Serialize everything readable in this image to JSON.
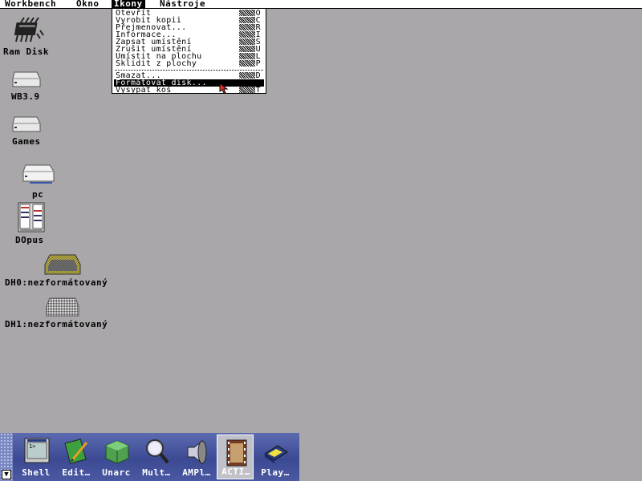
{
  "menubar": {
    "items": [
      "Workbench",
      "Okno",
      "Ikony",
      "Nástroje"
    ],
    "active": "Ikony"
  },
  "menu": {
    "items": [
      {
        "label": "Otevřít",
        "key": "O"
      },
      {
        "label": "Vyrobit kopii",
        "key": "C"
      },
      {
        "label": "Přejmenovat...",
        "key": "R"
      },
      {
        "label": "Informace...",
        "key": "I"
      },
      {
        "label": "Zapsat umístění",
        "key": "S"
      },
      {
        "label": "Zrušit umístění",
        "key": "U"
      },
      {
        "label": "Umístit na plochu",
        "key": "L"
      },
      {
        "label": "Sklidit z plochy",
        "key": "P"
      },
      {
        "label": "Smazat...",
        "key": "D"
      },
      {
        "label": "Formátovat disk...",
        "key": ""
      },
      {
        "label": "Vysypat koš",
        "key": "T"
      }
    ],
    "selected": "Formátovat disk..."
  },
  "desktop": {
    "icons": [
      {
        "label": "Ram Disk",
        "icon": "ram-disk-chip-icon"
      },
      {
        "label": "WB3.9",
        "icon": "drive-icon"
      },
      {
        "label": "Games",
        "icon": "drive-icon"
      },
      {
        "label": "pc",
        "icon": "drive-icon"
      },
      {
        "label": "DOpus",
        "icon": "dopus-app-icon"
      },
      {
        "label": "DH0:nezformátovaný",
        "icon": "unformatted-disk-icon"
      },
      {
        "label": "DH1:nezformátovaný",
        "icon": "unformatted-disk-icon"
      }
    ]
  },
  "dock": {
    "items": [
      {
        "label": "Shell",
        "icon": "shell-icon"
      },
      {
        "label": "Edit…",
        "icon": "edit-icon"
      },
      {
        "label": "Unarc",
        "icon": "unarc-icon"
      },
      {
        "label": "Mult…",
        "icon": "magnifier-icon"
      },
      {
        "label": "AMPl…",
        "icon": "speaker-icon"
      },
      {
        "label": "ACTI…",
        "icon": "film-icon"
      },
      {
        "label": "Play…",
        "icon": "play-disk-icon"
      }
    ]
  },
  "colors": {
    "desktop": "#aaa7aa",
    "dock": "#4b58a2",
    "menu_bg": "#ffffff"
  }
}
